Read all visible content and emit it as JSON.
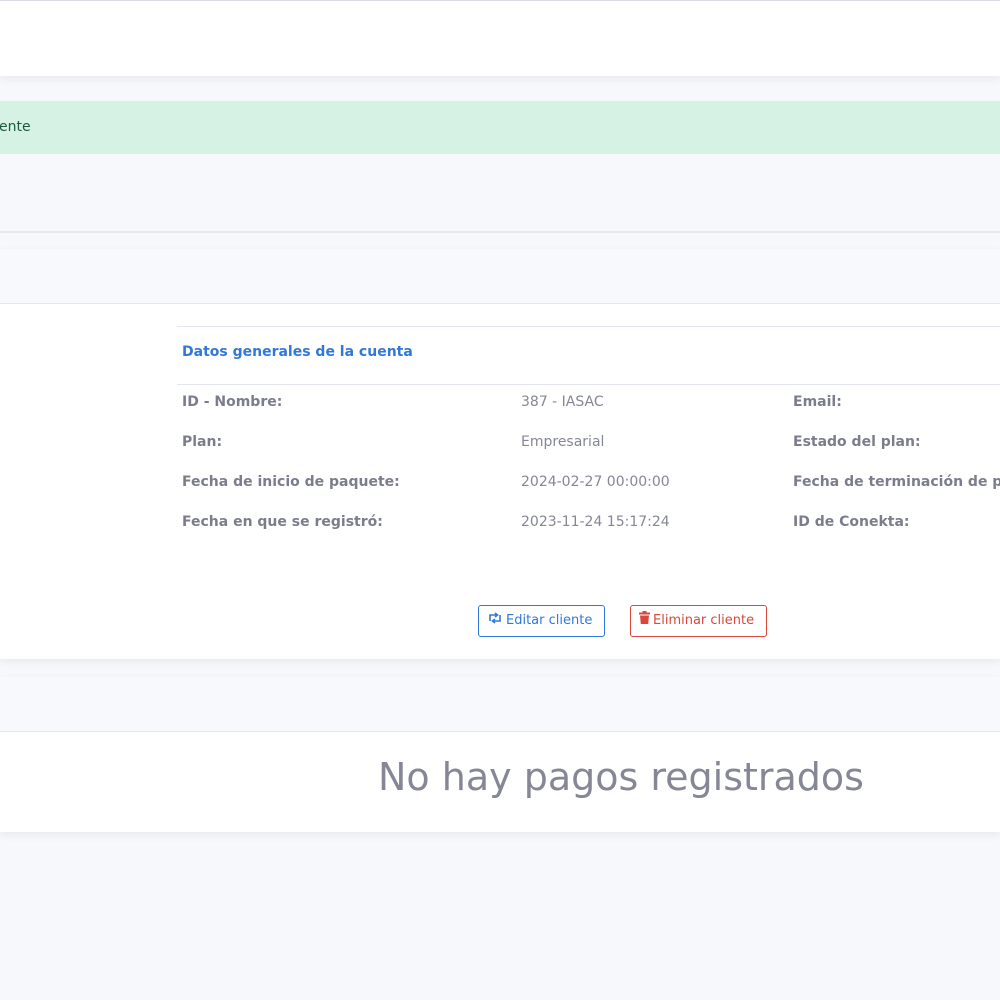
{
  "alert": {
    "text": "ente"
  },
  "account": {
    "section_title": "Datos generales de la cuenta",
    "rows": [
      {
        "label": "ID - Nombre:",
        "value": "387 - IASAC",
        "label2": "Email:"
      },
      {
        "label": "Plan:",
        "value": "Empresarial",
        "label2": "Estado del plan:"
      },
      {
        "label": "Fecha de inicio de paquete:",
        "value": "2024-02-27 00:00:00",
        "label2": "Fecha de terminación de pa"
      },
      {
        "label": "Fecha en que se registró:",
        "value": "2023-11-24 15:17:24",
        "label2": "ID de Conekta:"
      }
    ],
    "buttons": {
      "edit_label": "Editar cliente",
      "edit_icon": "retweet-icon",
      "delete_label": "Eliminar cliente",
      "delete_icon": "trash-icon"
    }
  },
  "payments": {
    "empty_message": "No hay pagos registrados"
  },
  "colors": {
    "accent": "#3178d8",
    "danger": "#d9483b",
    "success_bg": "#d6f2e4"
  }
}
